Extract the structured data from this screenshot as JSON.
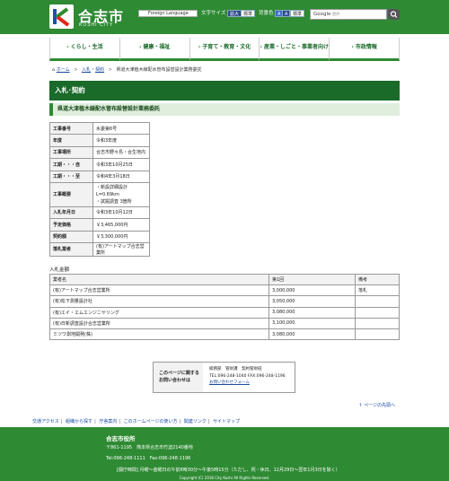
{
  "header": {
    "site_name": "合志市",
    "site_sub": "KOSHI CITY",
    "lang_label": "Foreign Language",
    "font_size_label": "文字サイズ",
    "font_large": "拡大",
    "font_standard": "標準",
    "bgcolor_label": "背景色",
    "bg_a1": "A",
    "bg_a2": "A",
    "bg_standard": "標準",
    "search_brand": "Google",
    "search_hint": "提供"
  },
  "gnav": [
    {
      "label": "くらし・生活"
    },
    {
      "label": "健康・福祉"
    },
    {
      "label": "子育て・教育・文化"
    },
    {
      "label": "産業・しごと・事業者向け"
    },
    {
      "label": "市政情報"
    }
  ],
  "breadcrumb": {
    "home": "ホーム",
    "c1": "入札",
    "c2": "契約",
    "current": "県道大津植木線配水管布設替設計業務委託"
  },
  "page_title": "入札･契約",
  "sub_title": "県道大津植木線配水管布設替設計業務委託",
  "info": {
    "rows": [
      {
        "k": "工事番号",
        "v": "水委第6号"
      },
      {
        "k": "年度",
        "v": "令和3年度"
      },
      {
        "k": "工事場所",
        "v": "合志市野々島・合生地内"
      },
      {
        "k": "工期・・・自",
        "v": "令和3年10月25日"
      },
      {
        "k": "工期・・・至",
        "v": "令和4年3月18日"
      }
    ],
    "summary_k": "工事概要",
    "summary_v1": "・新設詳細設計 L=0.69km",
    "summary_v2": "・試掘調査 3箇所",
    "rows2": [
      {
        "k": "入札年月日",
        "v": "令和3年10月12日"
      },
      {
        "k": "予定価格",
        "v": "￥3,465,000円"
      },
      {
        "k": "契約額",
        "v": "￥3,300,000円"
      },
      {
        "k": "落札業者",
        "v": "(有)アートマップ合志営業所"
      }
    ]
  },
  "bids": {
    "caption": "入札金額",
    "head": {
      "c1": "業者名",
      "c2": "第1回",
      "c3": "備考"
    },
    "rows": [
      {
        "c1": "(有)アートマップ合志営業所",
        "c2": "3,000,000",
        "c3": "落札"
      },
      {
        "c1": "(有)松下測量設計社",
        "c2": "3,050,000",
        "c3": ""
      },
      {
        "c1": "(有)エイ・エムエンジニヤリング",
        "c2": "3,080,000",
        "c3": ""
      },
      {
        "c1": "(有)日新調査設計合志営業所",
        "c2": "3,100,000",
        "c3": ""
      },
      {
        "c1": "ミツワ測地開発(株)",
        "c2": "3,080,000",
        "c3": ""
      }
    ]
  },
  "contact": {
    "head1": "このページに関する",
    "head2": "お問い合わせは",
    "dept": "総務部　管財課　契約管財班",
    "tel": "TEL:096-248-1040 FAX:096-248-1196",
    "form_link": "お問い合わせフォーム"
  },
  "pagetop": "ページの先頭へ",
  "fnav": [
    "交通アクセス",
    "組織から探す",
    "庁舎案内",
    "このホームページの使い方",
    "関連リンク",
    "サイトマップ"
  ],
  "footer": {
    "name": "合志市役所",
    "addr": "〒861-1195　熊本県合志市竹迫2140番地",
    "tel": "Tel:096-248-1111　Fax:096-248-1196",
    "hours": "[開庁時間] 月曜～金曜日の午前8時30分～午後5時15分（ただし、祝・休日、12月29日～翌年1月3日を除く）",
    "copy": "Copyright (C) 2018 City Koshi All Rights Reserved."
  },
  "colors": {
    "brand_green": "#2e8a33",
    "title_green": "#1a6a2a",
    "link": "#1a4aa0"
  }
}
